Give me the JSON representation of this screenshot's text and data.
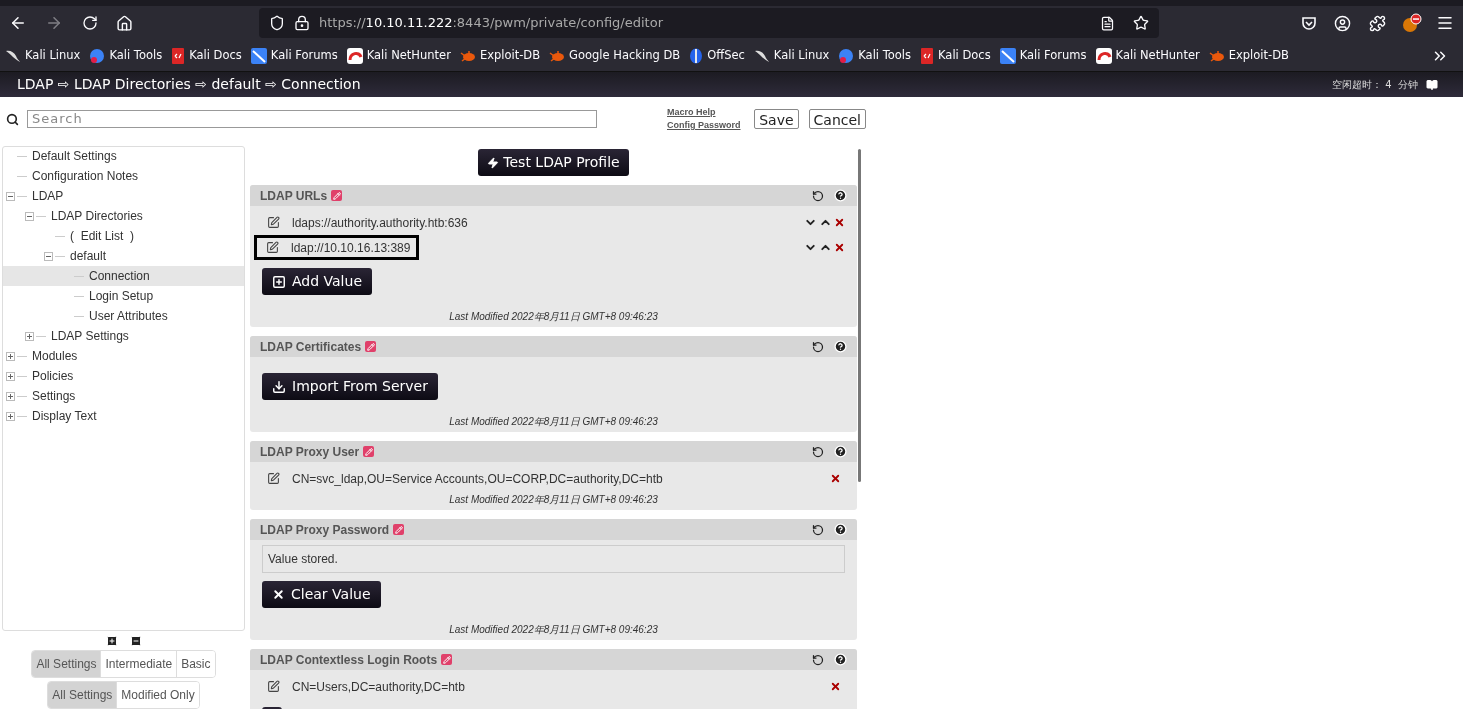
{
  "browser": {
    "url_scheme": "https://",
    "url_host": "10.10.11.222",
    "url_rest": ":8443/pwm/private/config/editor",
    "bookmarks": [
      {
        "label": "Kali Linux",
        "kind": "dragon"
      },
      {
        "label": "Kali Tools",
        "kind": "tools"
      },
      {
        "label": "Kali Docs",
        "kind": "docs"
      },
      {
        "label": "Kali Forums",
        "kind": "forums"
      },
      {
        "label": "Kali NetHunter",
        "kind": "nethunter"
      },
      {
        "label": "Exploit-DB",
        "kind": "bug"
      },
      {
        "label": "Google Hacking DB",
        "kind": "bug"
      },
      {
        "label": "OffSec",
        "kind": "offsec"
      },
      {
        "label": "Kali Linux",
        "kind": "dragon"
      },
      {
        "label": "Kali Tools",
        "kind": "tools"
      },
      {
        "label": "Kali Docs",
        "kind": "docs"
      },
      {
        "label": "Kali Forums",
        "kind": "forums"
      },
      {
        "label": "Kali NetHunter",
        "kind": "nethunter"
      },
      {
        "label": "Exploit-DB",
        "kind": "bug"
      }
    ]
  },
  "header": {
    "breadcrumb": "LDAP ⇨ LDAP Directories ⇨ default ⇨ Connection",
    "idle_label": "空闲超时：",
    "idle_value": "4",
    "idle_unit": "分钟"
  },
  "toolbar": {
    "search_placeholder": "Search",
    "links": [
      "Macro Help",
      "Config Password"
    ],
    "buttons": [
      "Save",
      "Cancel"
    ]
  },
  "tree": [
    {
      "label": "Default Settings",
      "selected": false
    },
    {
      "label": "Configuration Notes",
      "selected": false
    },
    {
      "label": "LDAP",
      "selected": false,
      "expanded": true,
      "children": [
        {
          "label": "LDAP Directories",
          "selected": false,
          "expanded": true,
          "children": [
            {
              "label": "(  Edit List  )",
              "selected": false
            },
            {
              "label": "default",
              "selected": false,
              "expanded": true,
              "children": [
                {
                  "label": "Connection",
                  "selected": true
                },
                {
                  "label": "Login Setup",
                  "selected": false
                },
                {
                  "label": "User Attributes",
                  "selected": false
                }
              ]
            }
          ]
        },
        {
          "label": "LDAP Settings",
          "selected": false,
          "expanded": false
        }
      ]
    },
    {
      "label": "Modules",
      "selected": false,
      "expanded": false
    },
    {
      "label": "Policies",
      "selected": false,
      "expanded": false
    },
    {
      "label": "Settings",
      "selected": false,
      "expanded": false
    },
    {
      "label": "Display Text",
      "selected": false,
      "expanded": false
    }
  ],
  "level_filter": [
    {
      "label": "All Settings",
      "selected": true
    },
    {
      "label": "Intermediate",
      "selected": false
    },
    {
      "label": "Basic",
      "selected": false
    }
  ],
  "modified_filter": [
    {
      "label": "All Settings",
      "selected": true
    },
    {
      "label": "Modified Only",
      "selected": false
    }
  ],
  "test_button": "Test LDAP Profile",
  "sections": [
    {
      "title": "LDAP URLs",
      "kind": "list",
      "values": [
        {
          "text": "ldaps://authority.authority.htb:636",
          "reorder": true,
          "outlined": false
        },
        {
          "text": "ldap://10.10.16.13:389",
          "reorder": true,
          "outlined": true
        }
      ],
      "button": {
        "kind": "add",
        "label": "Add Value"
      },
      "modified": "Last Modified 2022年8月11日 GMT+8 09:46:23"
    },
    {
      "title": "LDAP Certificates",
      "kind": "import",
      "button": {
        "kind": "import",
        "label": "Import From Server"
      },
      "modified": "Last Modified 2022年8月11日 GMT+8 09:46:23"
    },
    {
      "title": "LDAP Proxy User",
      "kind": "list",
      "values": [
        {
          "text": "CN=svc_ldap,OU=Service Accounts,OU=CORP,DC=authority,DC=htb",
          "reorder": false,
          "outlined": false
        }
      ],
      "modified": "Last Modified 2022年8月11日 GMT+8 09:46:23"
    },
    {
      "title": "LDAP Proxy Password",
      "kind": "stored",
      "value": "Value stored.",
      "button": {
        "kind": "clear",
        "label": "Clear Value"
      },
      "modified": "Last Modified 2022年8月11日 GMT+8 09:46:23"
    },
    {
      "title": "LDAP Contextless Login Roots",
      "kind": "list",
      "values": [
        {
          "text": "CN=Users,DC=authority,DC=htb",
          "reorder": false,
          "outlined": false
        }
      ],
      "button": {
        "kind": "add"
      }
    }
  ]
}
